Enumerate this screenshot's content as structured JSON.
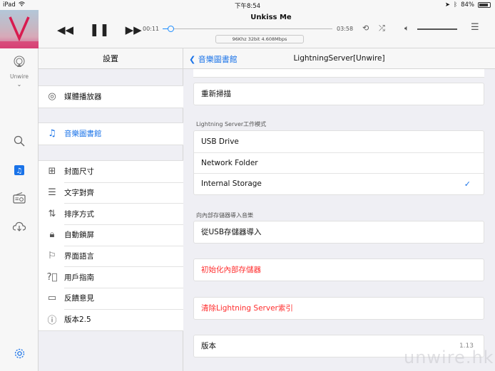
{
  "status": {
    "device": "iPad",
    "time": "下午8:54",
    "battery": "84%",
    "battery_level": 0.84
  },
  "player": {
    "song_title": "Unkiss Me",
    "elapsed": "00:11",
    "total": "03:58",
    "progress": 0.05,
    "format": "96Khz  32bit  4.608Mbps",
    "volume_level": 1.0
  },
  "rail": {
    "device_label": "Unwire"
  },
  "settings": {
    "title": "設置",
    "items": [
      {
        "label": "媒體播放器",
        "icon": "airplay-icon"
      },
      {
        "label": "音樂圖書館",
        "icon": "music-library-icon",
        "selected": true
      },
      {
        "label": "封面尺寸",
        "icon": "grid-icon"
      },
      {
        "label": "文字對齊",
        "icon": "align-icon"
      },
      {
        "label": "排序方式",
        "icon": "sort-icon"
      },
      {
        "label": "自動鎖屏",
        "icon": "lock-icon"
      },
      {
        "label": "界面語言",
        "icon": "flag-icon"
      },
      {
        "label": "用戶指南",
        "icon": "help-icon"
      },
      {
        "label": "反饋意見",
        "icon": "feedback-icon"
      },
      {
        "label": "版本2.5",
        "icon": "info-icon"
      }
    ]
  },
  "detail": {
    "back_label": "音樂圖書館",
    "title": "LightningServer[Unwire]",
    "rescan": "重新掃描",
    "mode_section": "Lightning Server工作模式",
    "modes": [
      "USB Drive",
      "Network Folder",
      "Internal Storage"
    ],
    "selected_mode": "Internal Storage",
    "import_section": "向內部存儲器導入音樂",
    "import_usb": "從USB存儲器導入",
    "init_storage": "初始化內部存儲器",
    "clear_index": "清除Lightning Server索引",
    "version_label": "版本",
    "version_value": "1.13"
  },
  "watermark": "unwire.hk"
}
